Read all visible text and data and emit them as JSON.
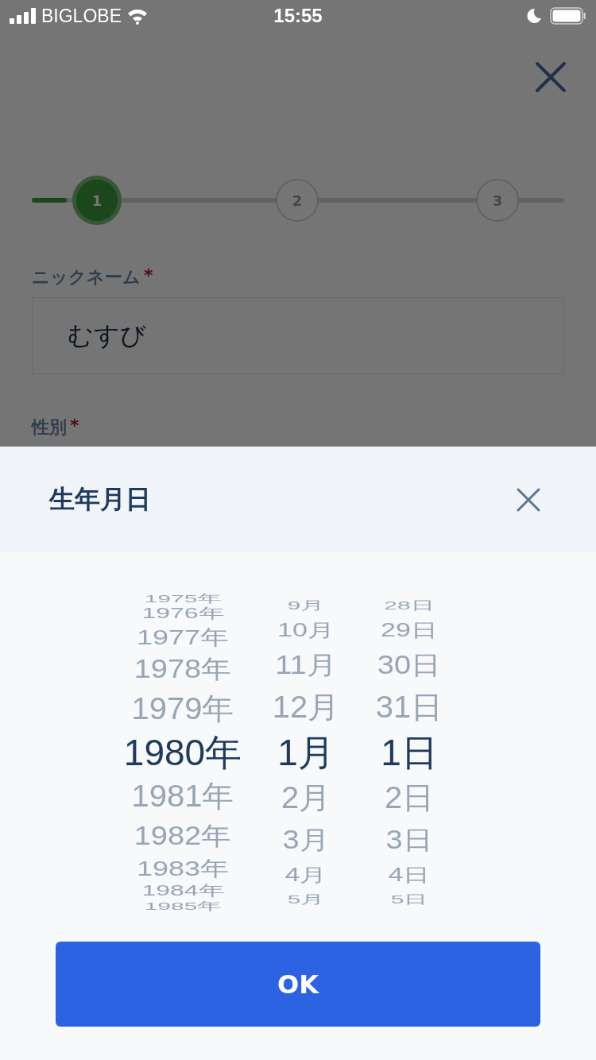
{
  "status_bar": {
    "carrier": "BIGLOBE",
    "time": "15:55"
  },
  "stepper": {
    "steps": [
      {
        "number": "1",
        "selected": true
      },
      {
        "number": "2",
        "selected": false
      },
      {
        "number": "3",
        "selected": false
      }
    ]
  },
  "form": {
    "fields": [
      {
        "label": "ニックネーム",
        "required_mark": "*",
        "value": "むすび"
      },
      {
        "label": "性別",
        "required_mark": "*"
      }
    ]
  },
  "sheet": {
    "title": "生年月日",
    "columns": [
      {
        "items": [
          {
            "text": "1975年",
            "selected": false
          },
          {
            "text": "1976年",
            "selected": false
          },
          {
            "text": "1977年",
            "selected": false
          },
          {
            "text": "1978年",
            "selected": false
          },
          {
            "text": "1979年",
            "selected": false
          },
          {
            "text": "1980年",
            "selected": true
          },
          {
            "text": "1981年",
            "selected": false
          },
          {
            "text": "1982年",
            "selected": false
          },
          {
            "text": "1983年",
            "selected": false
          },
          {
            "text": "1984年",
            "selected": false
          },
          {
            "text": "1985年",
            "selected": false
          }
        ]
      },
      {
        "items": [
          {
            "text": "9月",
            "selected": false
          },
          {
            "text": "10月",
            "selected": false
          },
          {
            "text": "11月",
            "selected": false
          },
          {
            "text": "12月",
            "selected": false
          },
          {
            "text": "1月",
            "selected": true
          },
          {
            "text": "2月",
            "selected": false
          },
          {
            "text": "3月",
            "selected": false
          },
          {
            "text": "4月",
            "selected": false
          },
          {
            "text": "5月",
            "selected": false
          }
        ]
      },
      {
        "items": [
          {
            "text": "28日",
            "selected": false
          },
          {
            "text": "29日",
            "selected": false
          },
          {
            "text": "30日",
            "selected": false
          },
          {
            "text": "31日",
            "selected": false
          },
          {
            "text": "1日",
            "selected": true
          },
          {
            "text": "2日",
            "selected": false
          },
          {
            "text": "3日",
            "selected": false
          },
          {
            "text": "4日",
            "selected": false
          },
          {
            "text": "5日",
            "selected": false
          }
        ]
      }
    ],
    "ok_button": "OK"
  }
}
